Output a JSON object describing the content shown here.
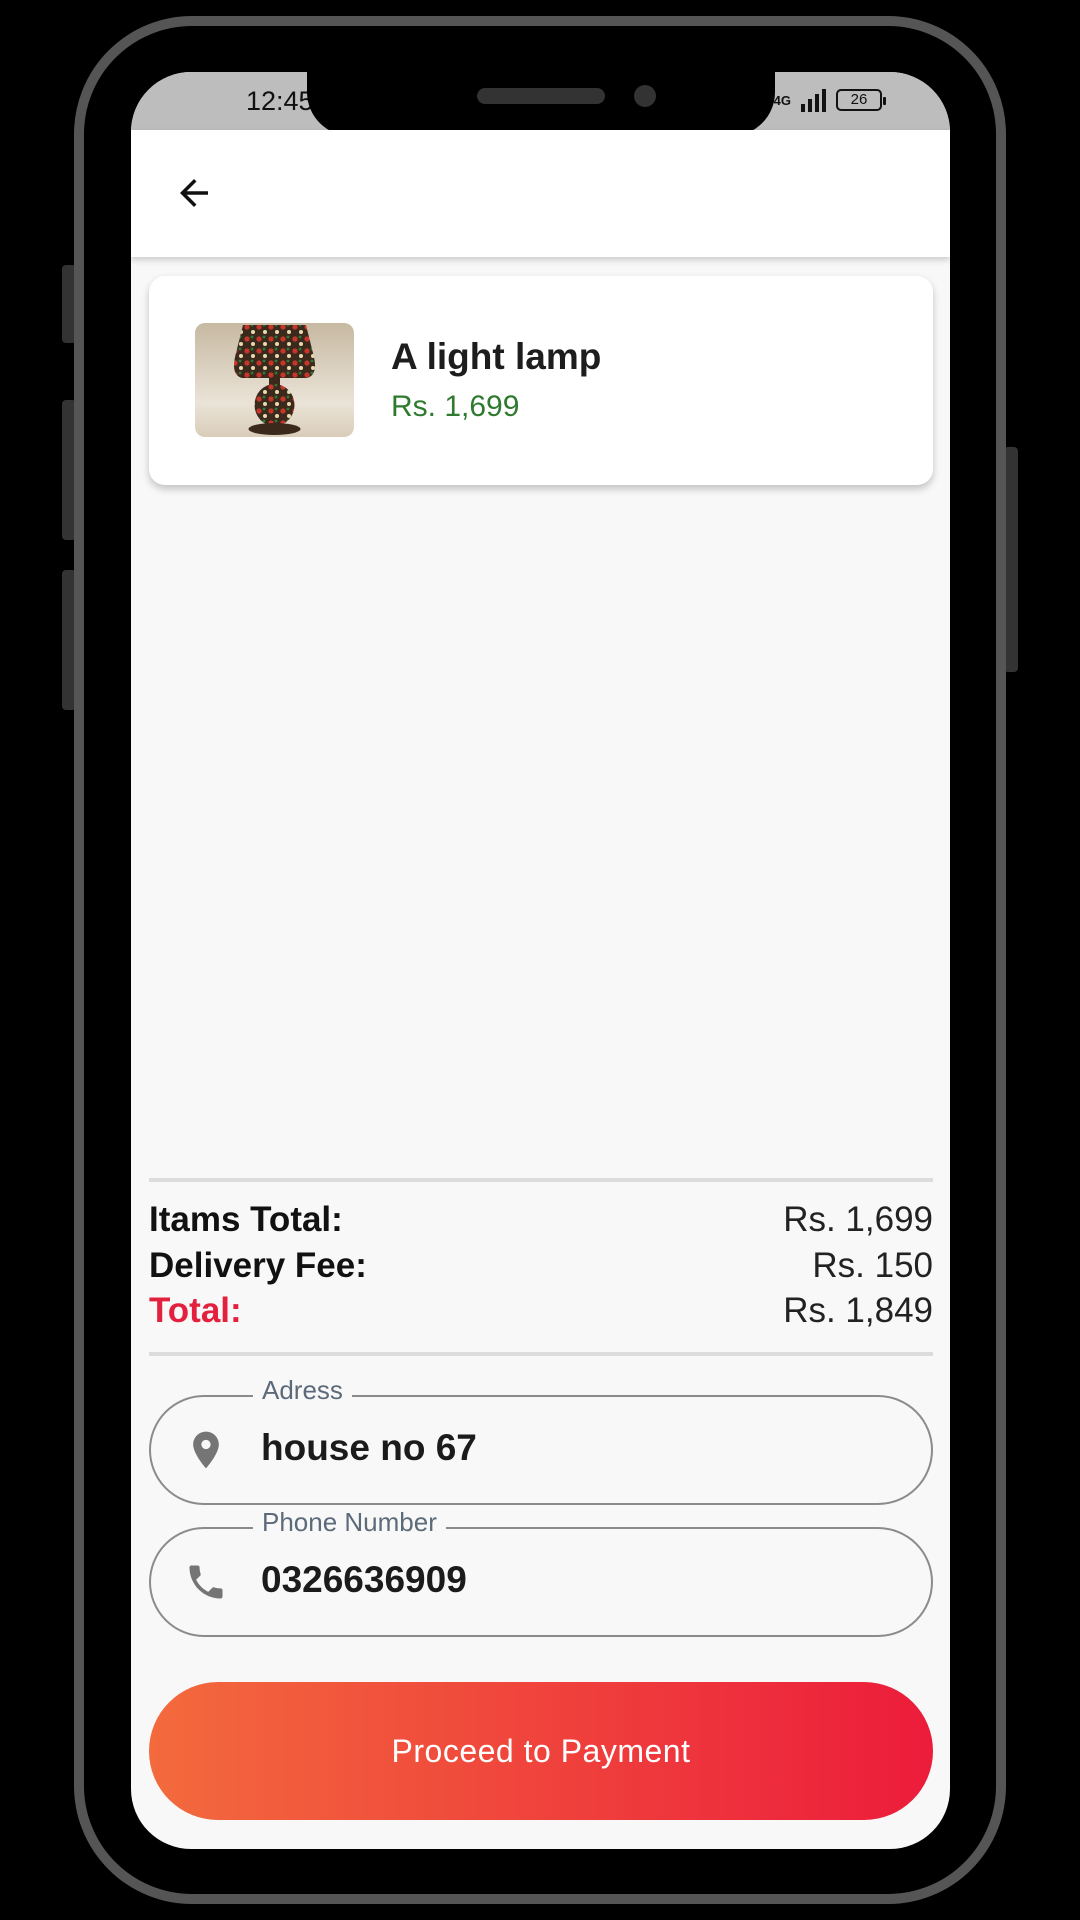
{
  "status_bar": {
    "time": "12:45",
    "network": "4G",
    "battery": "26"
  },
  "product": {
    "name": "A light lamp",
    "price": "Rs. 1,699"
  },
  "summary": {
    "items_total_label": "Itams Total:",
    "items_total_value": "Rs. 1,699",
    "delivery_fee_label": "Delivery Fee:",
    "delivery_fee_value": "Rs. 150",
    "total_label": "Total:",
    "total_value": "Rs. 1,849"
  },
  "address_field": {
    "label": "Adress",
    "value": "house no 67"
  },
  "phone_field": {
    "label": "Phone Number",
    "value": "0326636909"
  },
  "proceed_button": {
    "label": "Proceed to Payment"
  },
  "colors": {
    "price_green": "#2f7a2f",
    "total_red": "#e3213f",
    "button_gradient_start": "#f36a3d",
    "button_gradient_end": "#ec1c3b"
  },
  "icons": {
    "back": "arrow-back-icon",
    "address": "location-pin-icon",
    "phone": "phone-icon"
  }
}
